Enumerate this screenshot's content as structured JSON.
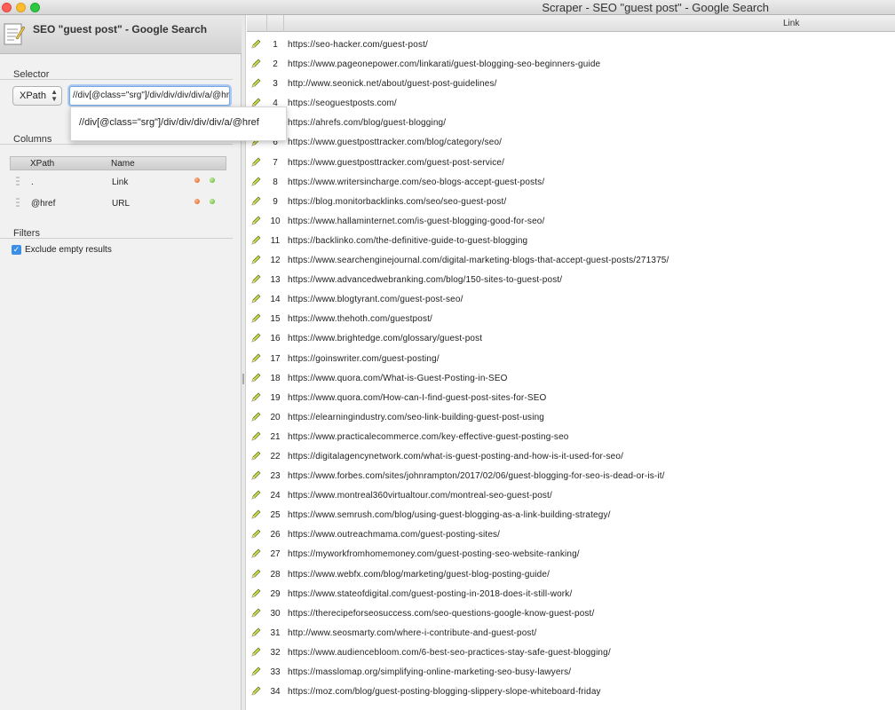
{
  "window": {
    "title": "Scraper - SEO \"guest post\" - Google Search"
  },
  "document": {
    "title": "SEO \"guest post\" - Google Search"
  },
  "selector": {
    "section_label": "Selector",
    "type_value": "XPath",
    "xpath_value": "//div[@class=\"srg\"]/div/div/div/div/a/@href",
    "autocomplete_suggestion": "//div[@class=\"srg\"]/div/div/div/div/a/@href"
  },
  "columns": {
    "section_label": "Columns",
    "headers": {
      "xpath": "XPath",
      "name": "Name"
    },
    "rows": [
      {
        "xpath": ".",
        "name": "Link"
      },
      {
        "xpath": "@href",
        "name": "URL"
      }
    ]
  },
  "filters": {
    "section_label": "Filters",
    "exclude_empty_label": "Exclude empty results",
    "exclude_empty_checked": true
  },
  "results": {
    "column_header": "Link",
    "rows": [
      {
        "n": "1",
        "url": "https://seo-hacker.com/guest-post/"
      },
      {
        "n": "2",
        "url": "https://www.pageonepower.com/linkarati/guest-blogging-seo-beginners-guide"
      },
      {
        "n": "3",
        "url": "http://www.seonick.net/about/guest-post-guidelines/"
      },
      {
        "n": "4",
        "url": "https://seoguestposts.com/"
      },
      {
        "n": "5",
        "url": "https://ahrefs.com/blog/guest-blogging/"
      },
      {
        "n": "6",
        "url": "https://www.guestposttracker.com/blog/category/seo/"
      },
      {
        "n": "7",
        "url": "https://www.guestposttracker.com/guest-post-service/"
      },
      {
        "n": "8",
        "url": "https://www.writersincharge.com/seo-blogs-accept-guest-posts/"
      },
      {
        "n": "9",
        "url": "https://blog.monitorbacklinks.com/seo/seo-guest-post/"
      },
      {
        "n": "10",
        "url": "https://www.hallaminternet.com/is-guest-blogging-good-for-seo/"
      },
      {
        "n": "11",
        "url": "https://backlinko.com/the-definitive-guide-to-guest-blogging"
      },
      {
        "n": "12",
        "url": "https://www.searchenginejournal.com/digital-marketing-blogs-that-accept-guest-posts/271375/"
      },
      {
        "n": "13",
        "url": "https://www.advancedwebranking.com/blog/150-sites-to-guest-post/"
      },
      {
        "n": "14",
        "url": "https://www.blogtyrant.com/guest-post-seo/"
      },
      {
        "n": "15",
        "url": "https://www.thehoth.com/guestpost/"
      },
      {
        "n": "16",
        "url": "https://www.brightedge.com/glossary/guest-post"
      },
      {
        "n": "17",
        "url": "https://goinswriter.com/guest-posting/"
      },
      {
        "n": "18",
        "url": "https://www.quora.com/What-is-Guest-Posting-in-SEO"
      },
      {
        "n": "19",
        "url": "https://www.quora.com/How-can-I-find-guest-post-sites-for-SEO"
      },
      {
        "n": "20",
        "url": "https://elearningindustry.com/seo-link-building-guest-post-using"
      },
      {
        "n": "21",
        "url": "https://www.practicalecommerce.com/key-effective-guest-posting-seo"
      },
      {
        "n": "22",
        "url": "https://digitalagencynetwork.com/what-is-guest-posting-and-how-is-it-used-for-seo/"
      },
      {
        "n": "23",
        "url": "https://www.forbes.com/sites/johnrampton/2017/02/06/guest-blogging-for-seo-is-dead-or-is-it/"
      },
      {
        "n": "24",
        "url": "https://www.montreal360virtualtour.com/montreal-seo-guest-post/"
      },
      {
        "n": "25",
        "url": "https://www.semrush.com/blog/using-guest-blogging-as-a-link-building-strategy/"
      },
      {
        "n": "26",
        "url": "https://www.outreachmama.com/guest-posting-sites/"
      },
      {
        "n": "27",
        "url": "https://myworkfromhomemoney.com/guest-posting-seo-website-ranking/"
      },
      {
        "n": "28",
        "url": "https://www.webfx.com/blog/marketing/guest-blog-posting-guide/"
      },
      {
        "n": "29",
        "url": "https://www.stateofdigital.com/guest-posting-in-2018-does-it-still-work/"
      },
      {
        "n": "30",
        "url": "https://therecipeforseosuccess.com/seo-questions-google-know-guest-post/"
      },
      {
        "n": "31",
        "url": "http://www.seosmarty.com/where-i-contribute-and-guest-post/"
      },
      {
        "n": "32",
        "url": "https://www.audiencebloom.com/6-best-seo-practices-stay-safe-guest-blogging/"
      },
      {
        "n": "33",
        "url": "https://masslomap.org/simplifying-online-marketing-seo-busy-lawyers/"
      },
      {
        "n": "34",
        "url": "https://moz.com/blog/guest-posting-blogging-slippery-slope-whiteboard-friday"
      }
    ]
  }
}
